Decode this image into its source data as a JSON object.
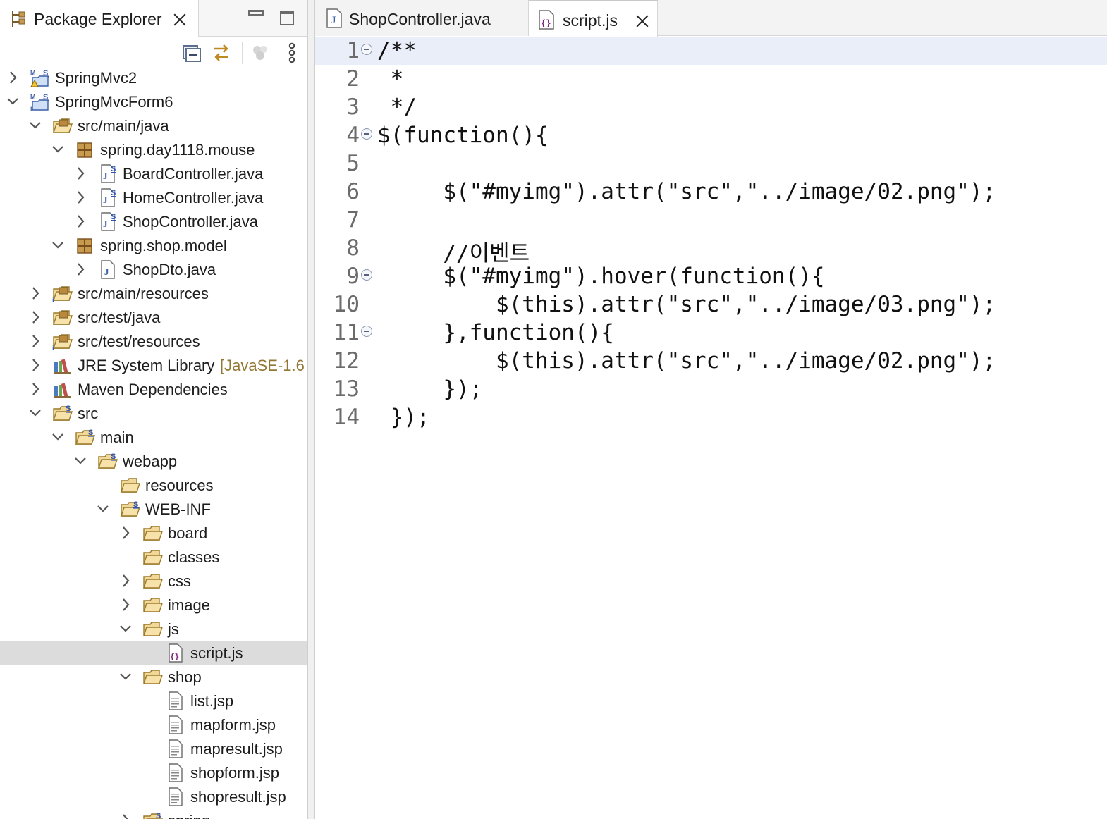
{
  "explorer": {
    "title": "Package Explorer",
    "toolbar_icons": [
      "collapse-all-icon",
      "link-with-editor-icon",
      "filter-icon",
      "view-menu-icon"
    ],
    "tree": [
      {
        "label": "SpringMvc2",
        "decor": "",
        "depth": 0,
        "expanded": false,
        "icon": "maven-project-warning-icon"
      },
      {
        "label": "SpringMvcForm6",
        "decor": "",
        "depth": 0,
        "expanded": true,
        "icon": "maven-project-icon"
      },
      {
        "label": "src/main/java",
        "decor": "",
        "depth": 1,
        "expanded": true,
        "icon": "source-folder-icon"
      },
      {
        "label": "spring.day1118.mouse",
        "decor": "",
        "depth": 2,
        "expanded": true,
        "icon": "package-icon"
      },
      {
        "label": "BoardController.java",
        "decor": "",
        "depth": 3,
        "expanded": false,
        "icon": "java-spring-file-icon"
      },
      {
        "label": "HomeController.java",
        "decor": "",
        "depth": 3,
        "expanded": false,
        "icon": "java-spring-file-icon"
      },
      {
        "label": "ShopController.java",
        "decor": "",
        "depth": 3,
        "expanded": false,
        "icon": "java-spring-file-icon"
      },
      {
        "label": "spring.shop.model",
        "decor": "",
        "depth": 2,
        "expanded": true,
        "icon": "package-icon"
      },
      {
        "label": "ShopDto.java",
        "decor": "",
        "depth": 3,
        "expanded": false,
        "icon": "java-file-icon"
      },
      {
        "label": "src/main/resources",
        "decor": "",
        "depth": 1,
        "expanded": false,
        "icon": "source-folder-info-icon"
      },
      {
        "label": "src/test/java",
        "decor": "",
        "depth": 1,
        "expanded": false,
        "icon": "source-folder-icon"
      },
      {
        "label": "src/test/resources",
        "decor": "",
        "depth": 1,
        "expanded": false,
        "icon": "source-folder-info-icon"
      },
      {
        "label": "JRE System Library",
        "decor": "[JavaSE-1.6",
        "depth": 1,
        "expanded": false,
        "icon": "library-icon"
      },
      {
        "label": "Maven Dependencies",
        "decor": "",
        "depth": 1,
        "expanded": false,
        "icon": "library-icon"
      },
      {
        "label": "src",
        "decor": "",
        "depth": 1,
        "expanded": true,
        "icon": "spring-folder-icon"
      },
      {
        "label": "main",
        "decor": "",
        "depth": 2,
        "expanded": true,
        "icon": "spring-folder-icon"
      },
      {
        "label": "webapp",
        "decor": "",
        "depth": 3,
        "expanded": true,
        "icon": "spring-folder-icon"
      },
      {
        "label": "resources",
        "decor": "",
        "depth": 4,
        "expanded": null,
        "icon": "folder-icon"
      },
      {
        "label": "WEB-INF",
        "decor": "",
        "depth": 4,
        "expanded": true,
        "icon": "spring-folder-icon"
      },
      {
        "label": "board",
        "decor": "",
        "depth": 5,
        "expanded": false,
        "icon": "folder-icon"
      },
      {
        "label": "classes",
        "decor": "",
        "depth": 5,
        "expanded": null,
        "icon": "folder-icon"
      },
      {
        "label": "css",
        "decor": "",
        "depth": 5,
        "expanded": false,
        "icon": "folder-icon"
      },
      {
        "label": "image",
        "decor": "",
        "depth": 5,
        "expanded": false,
        "icon": "folder-icon"
      },
      {
        "label": "js",
        "decor": "",
        "depth": 5,
        "expanded": true,
        "icon": "folder-icon"
      },
      {
        "label": "script.js",
        "decor": "",
        "depth": 6,
        "expanded": null,
        "icon": "js-file-icon",
        "selected": true
      },
      {
        "label": "shop",
        "decor": "",
        "depth": 5,
        "expanded": true,
        "icon": "folder-icon"
      },
      {
        "label": "list.jsp",
        "decor": "",
        "depth": 6,
        "expanded": null,
        "icon": "jsp-file-icon"
      },
      {
        "label": "mapform.jsp",
        "decor": "",
        "depth": 6,
        "expanded": null,
        "icon": "jsp-file-icon"
      },
      {
        "label": "mapresult.jsp",
        "decor": "",
        "depth": 6,
        "expanded": null,
        "icon": "jsp-file-icon"
      },
      {
        "label": "shopform.jsp",
        "decor": "",
        "depth": 6,
        "expanded": null,
        "icon": "jsp-file-icon"
      },
      {
        "label": "shopresult.jsp",
        "decor": "",
        "depth": 6,
        "expanded": null,
        "icon": "jsp-file-icon"
      },
      {
        "label": "spring",
        "decor": "",
        "depth": 5,
        "expanded": false,
        "icon": "spring-folder-icon"
      }
    ]
  },
  "editor": {
    "tabs": [
      {
        "label": "ShopController.java",
        "icon": "java-file-icon",
        "active": false
      },
      {
        "label": "script.js",
        "icon": "js-file-icon",
        "active": true
      }
    ],
    "lines": [
      {
        "no": "1",
        "text": "/**",
        "fold": true,
        "current": true
      },
      {
        "no": "2",
        "text": " *",
        "fold": false
      },
      {
        "no": "3",
        "text": " */",
        "fold": false
      },
      {
        "no": "4",
        "text": "$(function(){",
        "fold": true
      },
      {
        "no": "5",
        "text": "",
        "fold": false
      },
      {
        "no": "6",
        "text": "     $(\"#myimg\").attr(\"src\",\"../image/02.png\");",
        "fold": false
      },
      {
        "no": "7",
        "text": "",
        "fold": false
      },
      {
        "no": "8",
        "text": "     //이벤트",
        "fold": false
      },
      {
        "no": "9",
        "text": "     $(\"#myimg\").hover(function(){",
        "fold": true
      },
      {
        "no": "10",
        "text": "         $(this).attr(\"src\",\"../image/03.png\");",
        "fold": false
      },
      {
        "no": "11",
        "text": "     },function(){",
        "fold": true
      },
      {
        "no": "12",
        "text": "         $(this).attr(\"src\",\"../image/02.png\");",
        "fold": false
      },
      {
        "no": "13",
        "text": "     });",
        "fold": false
      },
      {
        "no": "14",
        "text": " });",
        "fold": false
      }
    ]
  },
  "colors": {
    "selection": "#dcdcdc",
    "current_line": "#e9eef9",
    "line_number": "#6b6b6b",
    "decoration": "#927733"
  }
}
